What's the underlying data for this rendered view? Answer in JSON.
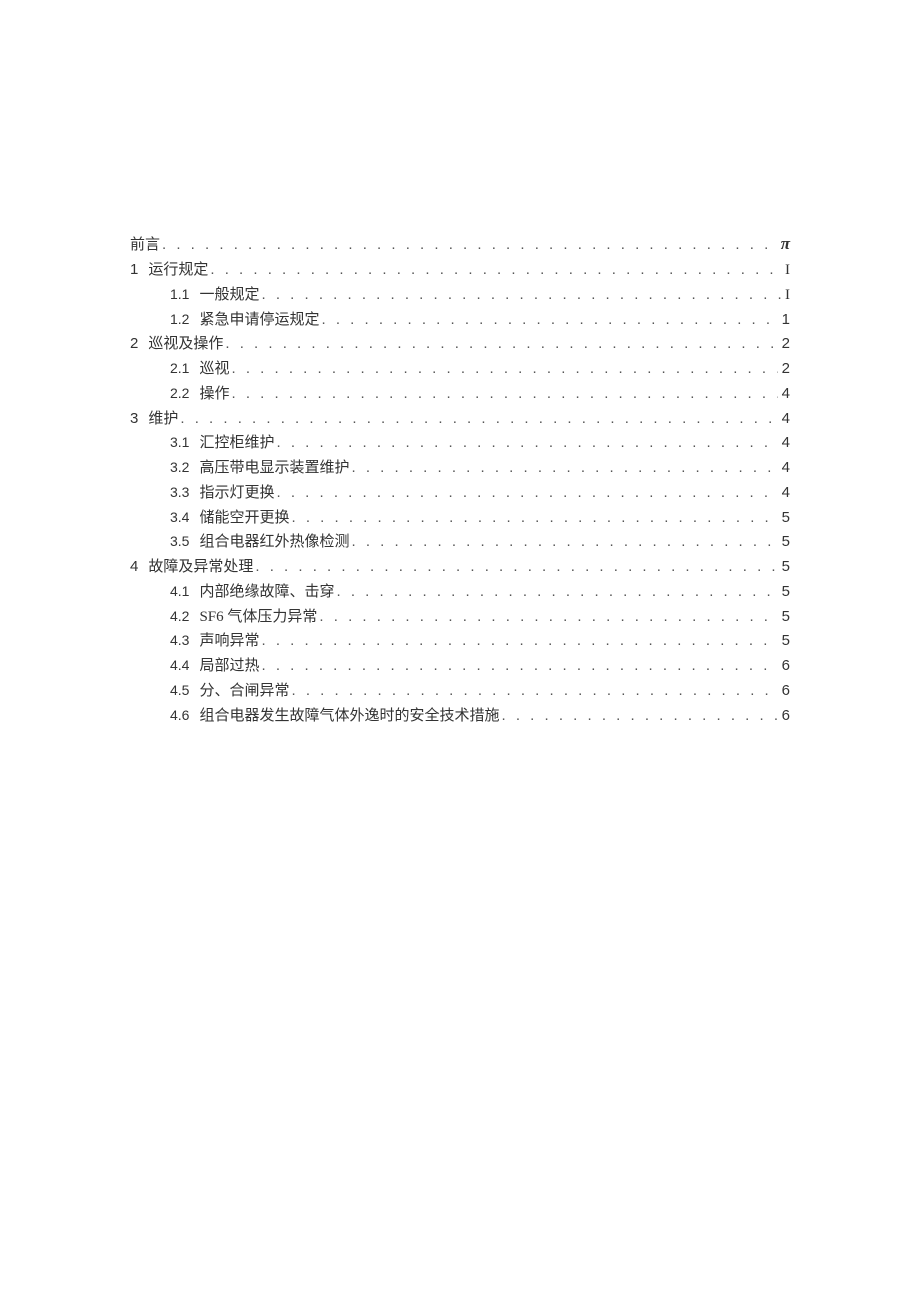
{
  "toc": [
    {
      "level": 1,
      "num": "",
      "title": "前言",
      "page": "π",
      "pageClass": "pi"
    },
    {
      "level": 1,
      "num": "1",
      "title": "运行规定",
      "page": "I",
      "pageClass": "roman"
    },
    {
      "level": 2,
      "num": "1.1",
      "title": "一般规定",
      "page": "I",
      "pageClass": "roman"
    },
    {
      "level": 2,
      "num": "1.2",
      "title": "紧急申请停运规定",
      "page": "1",
      "pageClass": ""
    },
    {
      "level": 1,
      "num": "2",
      "title": "巡视及操作",
      "page": "2",
      "pageClass": ""
    },
    {
      "level": 2,
      "num": "2.1",
      "title": "巡视",
      "page": "2",
      "pageClass": ""
    },
    {
      "level": 2,
      "num": "2.2",
      "title": "操作",
      "page": "4",
      "pageClass": ""
    },
    {
      "level": 1,
      "num": "3",
      "title": "维护",
      "page": "4",
      "pageClass": ""
    },
    {
      "level": 2,
      "num": "3.1",
      "title": "汇控柜维护",
      "page": "4",
      "pageClass": ""
    },
    {
      "level": 2,
      "num": "3.2",
      "title": "高压带电显示装置维护",
      "page": "4",
      "pageClass": ""
    },
    {
      "level": 2,
      "num": "3.3",
      "title": "指示灯更换",
      "page": "4",
      "pageClass": ""
    },
    {
      "level": 2,
      "num": "3.4",
      "title": "储能空开更换",
      "page": "5",
      "pageClass": ""
    },
    {
      "level": 2,
      "num": "3.5",
      "title": "组合电器红外热像检测",
      "page": "5",
      "pageClass": ""
    },
    {
      "level": 1,
      "num": "4",
      "title": "故障及异常处理",
      "page": "5",
      "pageClass": ""
    },
    {
      "level": 2,
      "num": "4.1",
      "title": "内部绝缘故障、击穿",
      "page": "5",
      "pageClass": ""
    },
    {
      "level": 2,
      "num": "4.2",
      "title": "SF6 气体压力异常",
      "page": "5",
      "pageClass": ""
    },
    {
      "level": 2,
      "num": "4.3",
      "title": "声响异常",
      "page": "5",
      "pageClass": ""
    },
    {
      "level": 2,
      "num": "4.4",
      "title": "局部过热",
      "page": "6",
      "pageClass": ""
    },
    {
      "level": 2,
      "num": "4.5",
      "title": "分、合闸异常",
      "page": "6",
      "pageClass": ""
    },
    {
      "level": 2,
      "num": "4.6",
      "title": "组合电器发生故障气体外逸时的安全技术措施",
      "page": "6",
      "pageClass": ""
    }
  ]
}
